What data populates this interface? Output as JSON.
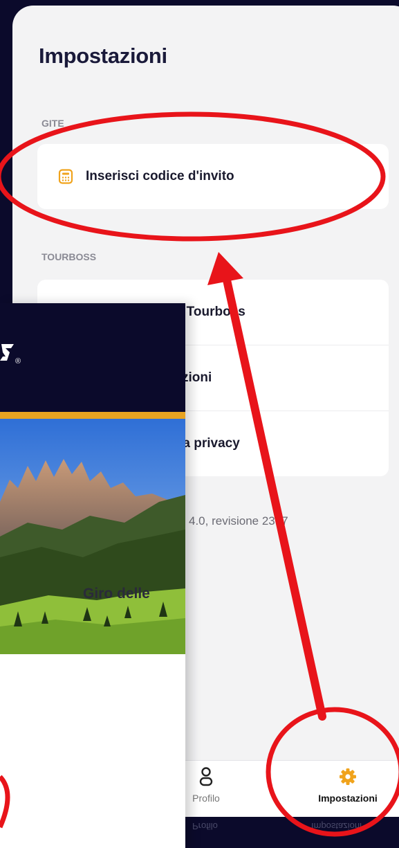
{
  "settings": {
    "title": "Impostazioni",
    "sections": [
      {
        "label": "GITE",
        "items": [
          {
            "label": "Inserisci codice d'invito",
            "icon": "calculator-icon"
          }
        ]
      },
      {
        "label": "TOURBOSS",
        "items": [
          {
            "label": "Informazioni su Tourboss",
            "icon": "document-icon"
          },
          {
            "label": "Termini e condizioni",
            "icon": "document-icon"
          },
          {
            "label": "Informativa sulla privacy",
            "icon": "shield-icon"
          }
        ]
      }
    ],
    "version_fragment": "4.0, revisione 2377"
  },
  "tabbar": {
    "profile_label": "Profilo",
    "settings_label": "Impostazioni"
  },
  "tour_card": {
    "title_fragment": "Giro delle",
    "registered_mark": "®"
  },
  "colors": {
    "navy": "#0b0a2b",
    "accent_orange": "#f0a31c",
    "gold_bar": "#e7a321",
    "annotation_red": "#e8141a"
  }
}
